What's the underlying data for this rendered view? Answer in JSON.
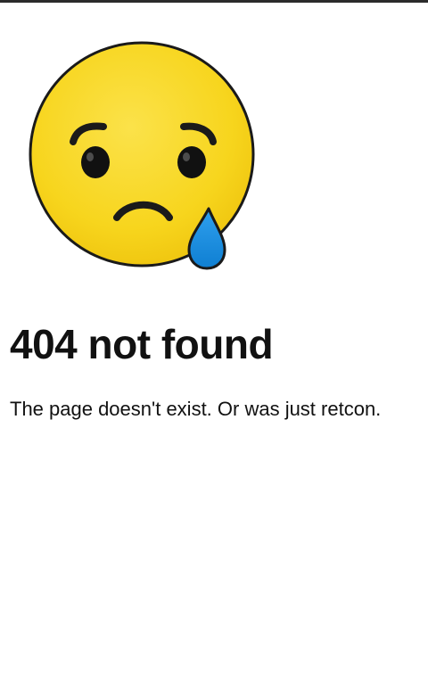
{
  "page": {
    "title": "404 not found",
    "message": "The page doesn't exist. Or was just retcon."
  },
  "illustration": {
    "icon": "sad-crying-face-icon",
    "face_color": "#F7D51D",
    "outline_color": "#1a1a1a",
    "tear_color": "#1E8FE0"
  }
}
